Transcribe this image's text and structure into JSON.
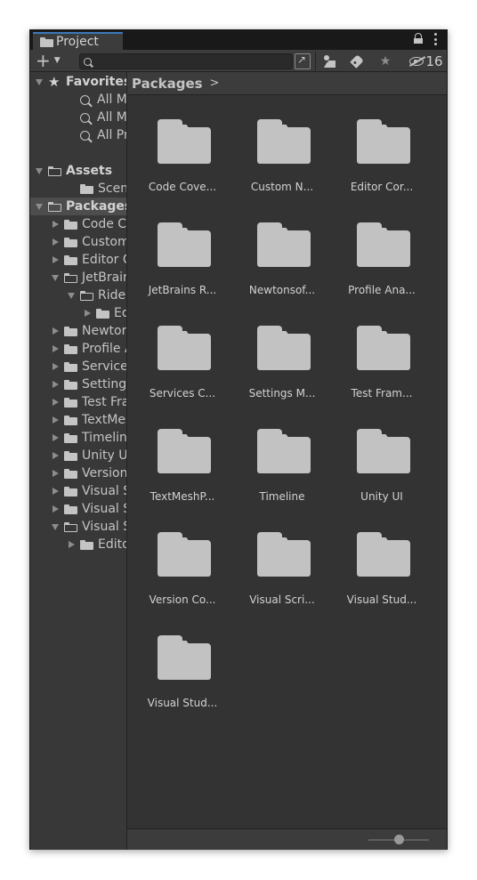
{
  "window": {
    "tab_title": "Project",
    "hidden_count": "16"
  },
  "toolbar": {
    "create_icon": "plus-icon",
    "search_placeholder": "",
    "search_value": ""
  },
  "tree": [
    {
      "label": "Favorites",
      "type": "star",
      "arrow": "down",
      "bold": true,
      "indent": 0
    },
    {
      "label": "All Materials",
      "type": "search",
      "arrow": "none",
      "bold": false,
      "indent": 2
    },
    {
      "label": "All Models",
      "type": "search",
      "arrow": "none",
      "bold": false,
      "indent": 2
    },
    {
      "label": "All Prefabs",
      "type": "search",
      "arrow": "none",
      "bold": false,
      "indent": 2
    },
    {
      "label": "",
      "type": "spacer",
      "arrow": "none",
      "bold": false,
      "indent": 0
    },
    {
      "label": "Assets",
      "type": "folder-open",
      "arrow": "down",
      "bold": true,
      "indent": 0
    },
    {
      "label": "Scenes",
      "type": "folder",
      "arrow": "none",
      "bold": false,
      "indent": 2
    },
    {
      "label": "Packages",
      "type": "folder-open",
      "arrow": "down",
      "bold": true,
      "indent": 0,
      "selected": true
    },
    {
      "label": "Code Coverage",
      "type": "folder",
      "arrow": "right",
      "bold": false,
      "indent": 1
    },
    {
      "label": "Custom NUnit",
      "type": "folder",
      "arrow": "right",
      "bold": false,
      "indent": 1
    },
    {
      "label": "Editor Coroutines",
      "type": "folder",
      "arrow": "right",
      "bold": false,
      "indent": 1
    },
    {
      "label": "JetBrains Rider Editor",
      "type": "folder-open",
      "arrow": "down",
      "bold": false,
      "indent": 1
    },
    {
      "label": "Rider",
      "type": "folder-open",
      "arrow": "down",
      "bold": false,
      "indent": 2
    },
    {
      "label": "Editor",
      "type": "folder",
      "arrow": "right",
      "bold": false,
      "indent": 3
    },
    {
      "label": "Newtonsoft Json",
      "type": "folder",
      "arrow": "right",
      "bold": false,
      "indent": 1
    },
    {
      "label": "Profile Analyzer",
      "type": "folder",
      "arrow": "right",
      "bold": false,
      "indent": 1
    },
    {
      "label": "Services Core",
      "type": "folder",
      "arrow": "right",
      "bold": false,
      "indent": 1
    },
    {
      "label": "Settings Manager",
      "type": "folder",
      "arrow": "right",
      "bold": false,
      "indent": 1
    },
    {
      "label": "Test Framework",
      "type": "folder",
      "arrow": "right",
      "bold": false,
      "indent": 1
    },
    {
      "label": "TextMeshPro",
      "type": "folder",
      "arrow": "right",
      "bold": false,
      "indent": 1
    },
    {
      "label": "Timeline",
      "type": "folder",
      "arrow": "right",
      "bold": false,
      "indent": 1
    },
    {
      "label": "Unity UI",
      "type": "folder",
      "arrow": "right",
      "bold": false,
      "indent": 1
    },
    {
      "label": "Version Control",
      "type": "folder",
      "arrow": "right",
      "bold": false,
      "indent": 1
    },
    {
      "label": "Visual Scripting",
      "type": "folder",
      "arrow": "right",
      "bold": false,
      "indent": 1
    },
    {
      "label": "Visual Studio Code Editor",
      "type": "folder",
      "arrow": "right",
      "bold": false,
      "indent": 1
    },
    {
      "label": "Visual Studio Editor",
      "type": "folder-open",
      "arrow": "down",
      "bold": false,
      "indent": 1
    },
    {
      "label": "Editor",
      "type": "folder",
      "arrow": "right",
      "bold": false,
      "indent": 2
    }
  ],
  "breadcrumb": {
    "label": "Packages",
    "arrow": ">"
  },
  "grid_items": [
    "Code Cove...",
    "Custom N...",
    "Editor Cor...",
    "JetBrains R...",
    "Newtonsof...",
    "Profile Ana...",
    "Services C...",
    "Settings M...",
    "Test Fram...",
    "TextMeshP...",
    "Timeline",
    "Unity UI",
    "Version Co...",
    "Visual Scri...",
    "Visual Stud...",
    "Visual Stud..."
  ],
  "zoom_slider_value": 0.5,
  "colors": {
    "panel": "#383838",
    "content": "#333333",
    "selection": "#4d4d4d",
    "accent": "#3a79bb",
    "folder": "#c2c2c2"
  }
}
